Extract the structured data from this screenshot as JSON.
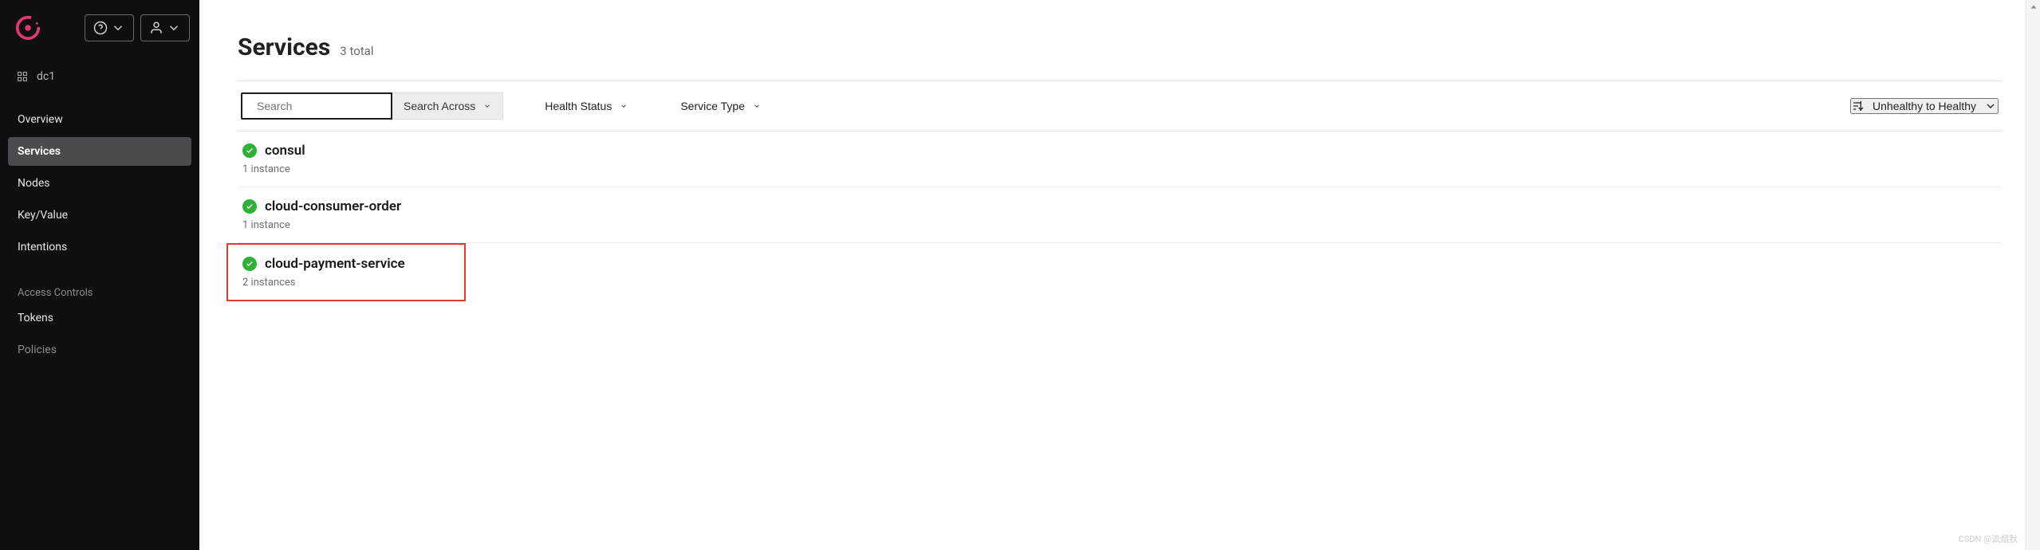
{
  "datacenter": "dc1",
  "nav": {
    "items": [
      {
        "label": "Overview"
      },
      {
        "label": "Services"
      },
      {
        "label": "Nodes"
      },
      {
        "label": "Key/Value"
      },
      {
        "label": "Intentions"
      }
    ],
    "access_section_label": "Access Controls",
    "access_items": [
      {
        "label": "Tokens"
      },
      {
        "label": "Policies"
      }
    ]
  },
  "page": {
    "title": "Services",
    "count_text": "3 total"
  },
  "filters": {
    "search_placeholder": "Search",
    "search_across": "Search Across",
    "health_status": "Health Status",
    "service_type": "Service Type",
    "sort_label": "Unhealthy to Healthy"
  },
  "services": [
    {
      "name": "consul",
      "instances": "1 instance",
      "status": "passing"
    },
    {
      "name": "cloud-consumer-order",
      "instances": "1 instance",
      "status": "passing"
    },
    {
      "name": "cloud-payment-service",
      "instances": "2 instances",
      "status": "passing",
      "highlight": true
    }
  ],
  "watermark": "CSDN @流烟默"
}
